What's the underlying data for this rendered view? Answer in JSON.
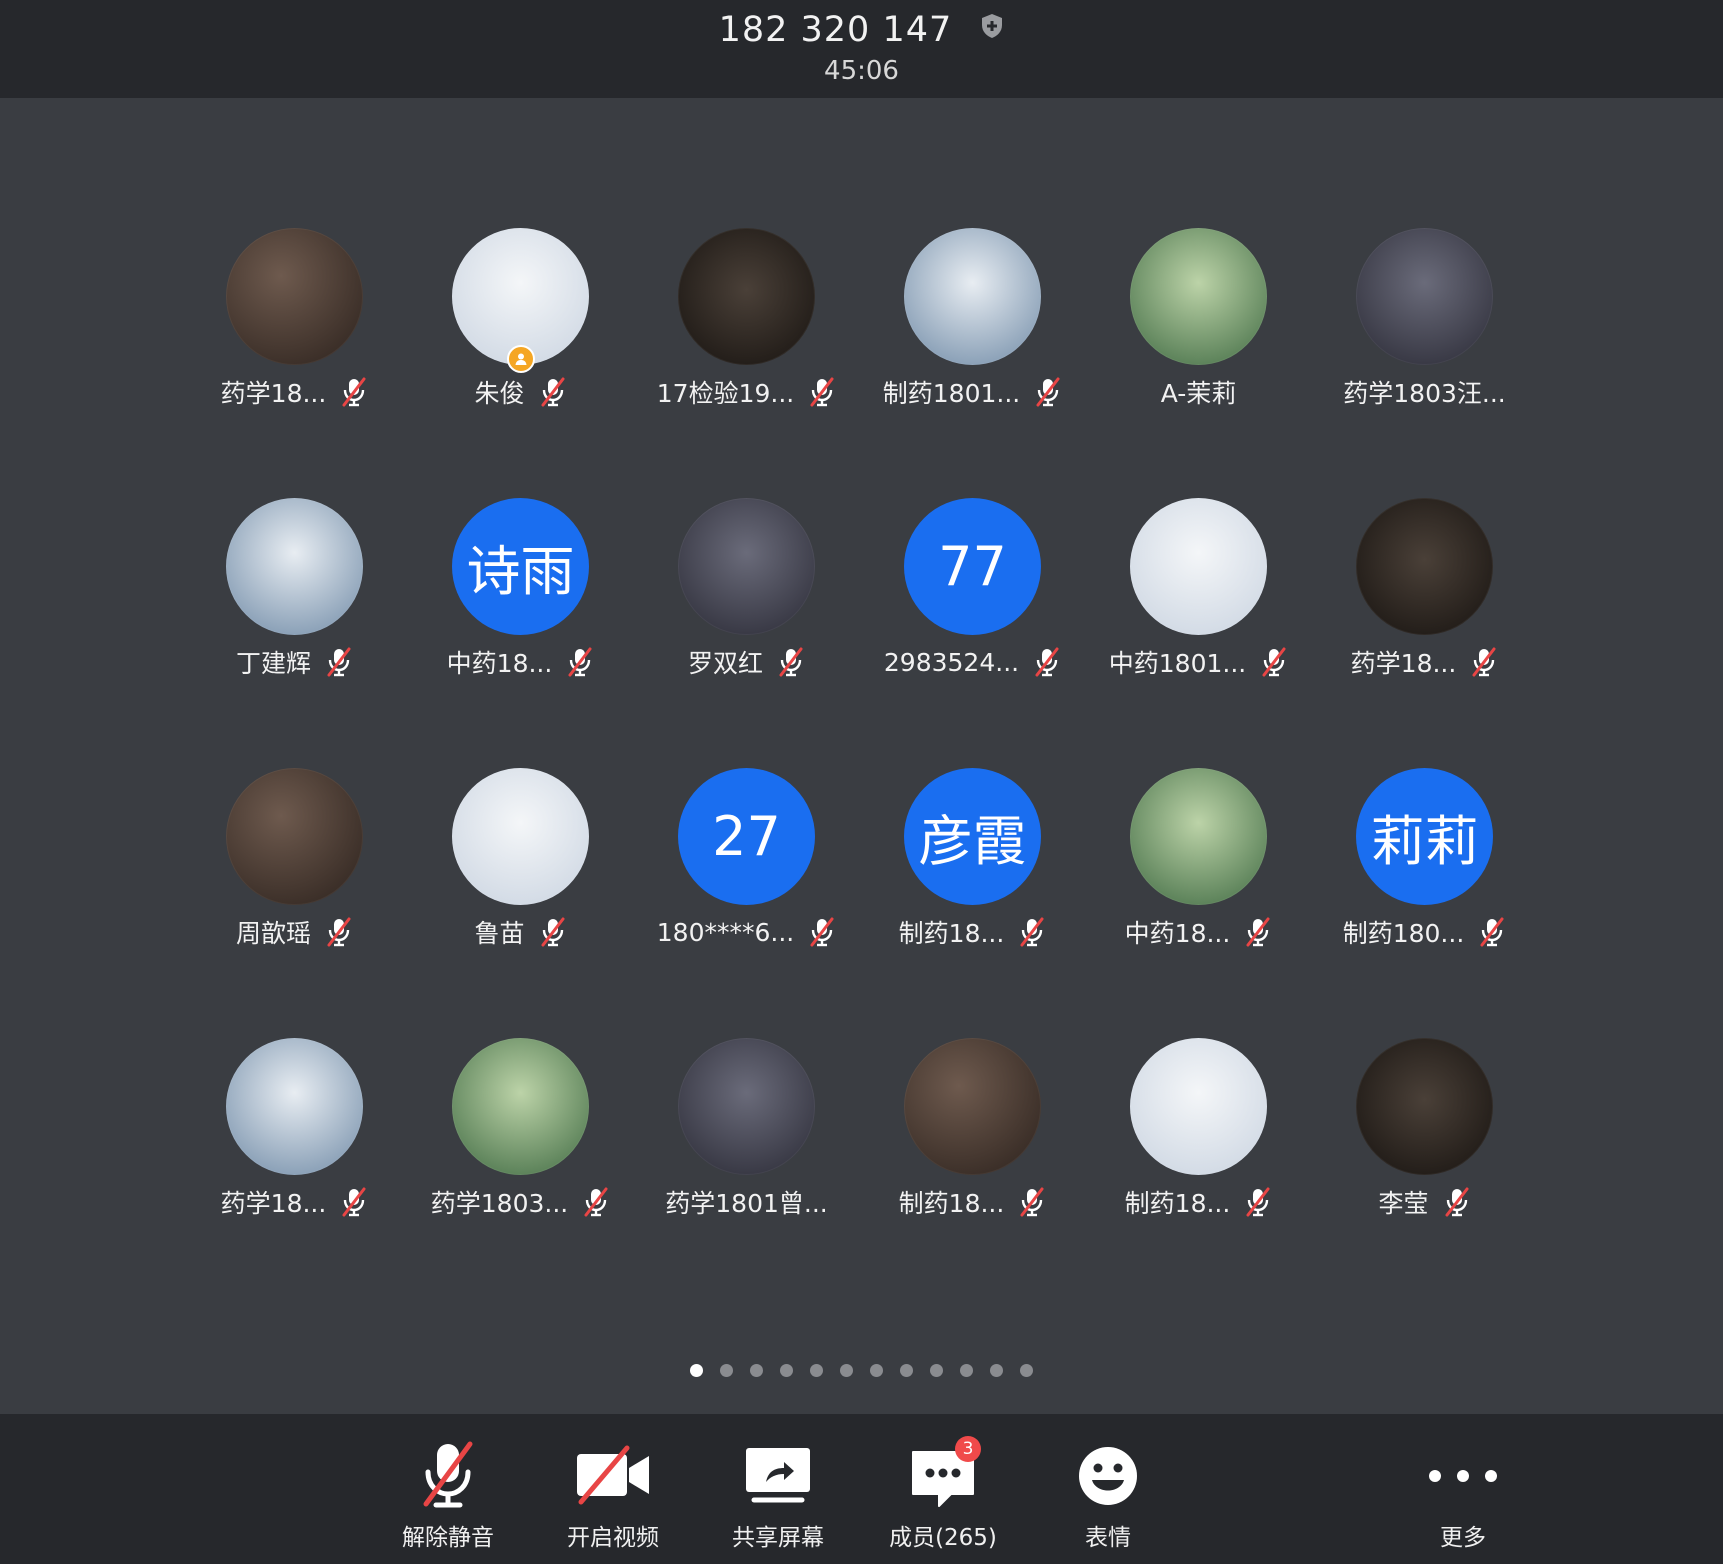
{
  "header": {
    "meeting_id": "182 320 147",
    "timer": "45:06",
    "security_icon": "shield-icon"
  },
  "colors": {
    "header_bg": "#26282c",
    "grid_bg": "#3a3d42",
    "initials_avatar_bg": "#1a6ef0",
    "host_badge": "#f5a623",
    "muted_slash": "#e84545",
    "badge_red": "#f04a4a"
  },
  "participants": [
    {
      "name": "药学18...",
      "avatar": "photo",
      "muted": true
    },
    {
      "name": "朱俊",
      "avatar": "photo",
      "muted": true,
      "host": true
    },
    {
      "name": "17检验19...",
      "avatar": "photo",
      "muted": true
    },
    {
      "name": "制药1801...",
      "avatar": "photo",
      "muted": true
    },
    {
      "name": "A-茉莉",
      "avatar": "photo",
      "muted": false
    },
    {
      "name": "药学1803汪...",
      "avatar": "photo",
      "muted": false
    },
    {
      "name": "丁建辉",
      "avatar": "photo",
      "muted": true
    },
    {
      "name": "中药18...",
      "avatar": "initials",
      "initials": "诗雨",
      "muted": true
    },
    {
      "name": "罗双红",
      "avatar": "photo",
      "muted": true
    },
    {
      "name": "2983524...",
      "avatar": "initials",
      "initials": "77",
      "muted": true
    },
    {
      "name": "中药1801...",
      "avatar": "photo",
      "muted": true
    },
    {
      "name": "药学18...",
      "avatar": "photo",
      "muted": true
    },
    {
      "name": "周歆瑶",
      "avatar": "photo",
      "muted": true
    },
    {
      "name": "鲁苗",
      "avatar": "photo",
      "muted": true
    },
    {
      "name": "180****6...",
      "avatar": "initials",
      "initials": "27",
      "muted": true
    },
    {
      "name": "制药18...",
      "avatar": "initials",
      "initials": "彦霞",
      "muted": true
    },
    {
      "name": "中药18...",
      "avatar": "photo",
      "muted": true
    },
    {
      "name": "制药180...",
      "avatar": "initials",
      "initials": "莉莉",
      "muted": true
    },
    {
      "name": "药学18...",
      "avatar": "photo",
      "muted": true
    },
    {
      "name": "药学1803...",
      "avatar": "photo",
      "muted": true
    },
    {
      "name": "药学1801曾...",
      "avatar": "photo",
      "muted": false
    },
    {
      "name": "制药18...",
      "avatar": "photo",
      "muted": true
    },
    {
      "name": "制药18...",
      "avatar": "photo",
      "muted": true
    },
    {
      "name": "李莹",
      "avatar": "photo",
      "muted": true
    }
  ],
  "pagination": {
    "total_pages": 12,
    "current_page": 1
  },
  "toolbar": {
    "unmute": {
      "label": "解除静音",
      "icon": "mic-off-icon"
    },
    "video": {
      "label": "开启视频",
      "icon": "video-off-icon"
    },
    "share": {
      "label": "共享屏幕",
      "icon": "share-screen-icon"
    },
    "members": {
      "label": "成员(265)",
      "icon": "chat-members-icon",
      "badge": "3"
    },
    "reactions": {
      "label": "表情",
      "icon": "smiley-icon"
    },
    "more": {
      "label": "更多",
      "icon": "more-dots-icon"
    }
  }
}
